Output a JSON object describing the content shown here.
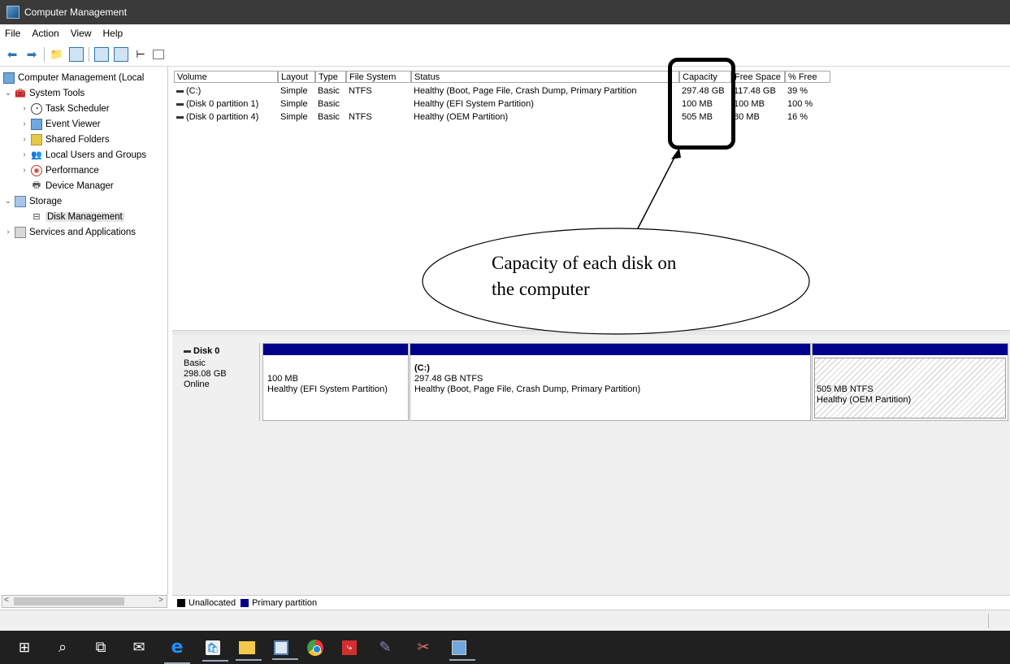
{
  "window": {
    "title": "Computer Management"
  },
  "menu": [
    "File",
    "Action",
    "View",
    "Help"
  ],
  "tree": {
    "root": "Computer Management (Local",
    "system_tools": "System Tools",
    "task_scheduler": "Task Scheduler",
    "event_viewer": "Event Viewer",
    "shared_folders": "Shared Folders",
    "local_users": "Local Users and Groups",
    "performance": "Performance",
    "device_manager": "Device Manager",
    "storage": "Storage",
    "disk_management": "Disk Management",
    "services": "Services and Applications"
  },
  "volumes": {
    "columns": [
      "Volume",
      "Layout",
      "Type",
      "File System",
      "Status",
      "Capacity",
      "Free Space",
      "% Free"
    ],
    "rows": [
      [
        "(C:)",
        "Simple",
        "Basic",
        "NTFS",
        "Healthy (Boot, Page File, Crash Dump, Primary Partition",
        "297.48 GB",
        "117.48 GB",
        "39 %"
      ],
      [
        "(Disk 0 partition 1)",
        "Simple",
        "Basic",
        "",
        "Healthy (EFI System Partition)",
        "100 MB",
        "100 MB",
        "100 %"
      ],
      [
        "(Disk 0 partition 4)",
        "Simple",
        "Basic",
        "NTFS",
        "Healthy (OEM Partition)",
        "505 MB",
        "80 MB",
        "16 %"
      ]
    ]
  },
  "disk": {
    "name": "Disk 0",
    "type": "Basic",
    "size": "298.08 GB",
    "status": "Online",
    "partitions": [
      {
        "line1": "100 MB",
        "line2": "Healthy (EFI System Partition)"
      },
      {
        "label": "(C:)",
        "line1": "297.48 GB NTFS",
        "line2": "Healthy (Boot, Page File, Crash Dump, Primary Partition)"
      },
      {
        "line1": "505 MB NTFS",
        "line2": "Healthy (OEM Partition)"
      }
    ]
  },
  "legend": {
    "unallocated": "Unallocated",
    "primary": "Primary partition"
  },
  "annotation": {
    "line1": "Capacity of each disk on",
    "line2": "the computer"
  },
  "colors": {
    "primary_partition": "#00008b",
    "titlebar": "#3a3a3a",
    "taskbar": "#202020"
  }
}
